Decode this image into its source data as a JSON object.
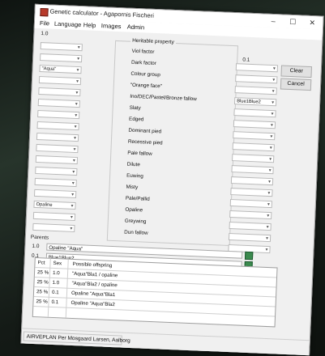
{
  "window": {
    "title": "Genetic calculator - Agapornis Fischeri",
    "controls": [
      "–",
      "☐",
      "✕"
    ]
  },
  "menu": [
    "File",
    "Language",
    "Help",
    "Images",
    "Admin"
  ],
  "parent_labels": {
    "left": "1.0",
    "right": "0.1"
  },
  "heritable": {
    "label": "Heritable property",
    "traits": [
      "Viol factor",
      "Dark factor",
      "Colour group",
      "\"Orange face\"",
      "Ino/DEC/Pastel/Bronze fallow",
      "Slaty",
      "Edged",
      "Dominant pied",
      "Recessive pied",
      "Pale fallow",
      "Dilute",
      "Euwing",
      "Misty",
      "Pale/Pallid",
      "Opaline",
      "Greywing",
      "Dun fallow"
    ]
  },
  "left_combos": [
    "",
    "",
    "\"Aqua\"",
    "",
    "",
    "",
    "",
    "",
    "",
    "",
    "",
    "",
    "",
    "",
    "Opaline",
    "",
    ""
  ],
  "right_combos": [
    "",
    "",
    "",
    "Blue1Blue2",
    "",
    "",
    "",
    "",
    "",
    "",
    "",
    "",
    "",
    "",
    "",
    "",
    ""
  ],
  "buttons": {
    "clear": "Clear",
    "cancel": "Cancel"
  },
  "parents": {
    "label": "Parents",
    "male_label": "1.0",
    "male_value": "Opaline \"Aqua\"",
    "female_label": "0.1",
    "female_value": "Blue1Blue2"
  },
  "offspring": {
    "headers": [
      "Pct",
      "Sex",
      "Possible offspring"
    ],
    "rows": [
      [
        "25 %",
        "1.0",
        "\"Aqua\"Bla1 / opaline"
      ],
      [
        "25 %",
        "1.0",
        "\"Aqua\"Bla2 / opaline"
      ],
      [
        "25 %",
        "0.1",
        "Opaline \"Aqua\"Bla1"
      ],
      [
        "25 %",
        "0.1",
        "Opaline \"Aqua\"Bla2"
      ]
    ]
  },
  "status": "AIRVEPLAN Per Mosgaard Larsen, Aalborg",
  "colors": {
    "accent_swatch": "#3b8a4e",
    "window_bg": "#f0f0f0"
  }
}
